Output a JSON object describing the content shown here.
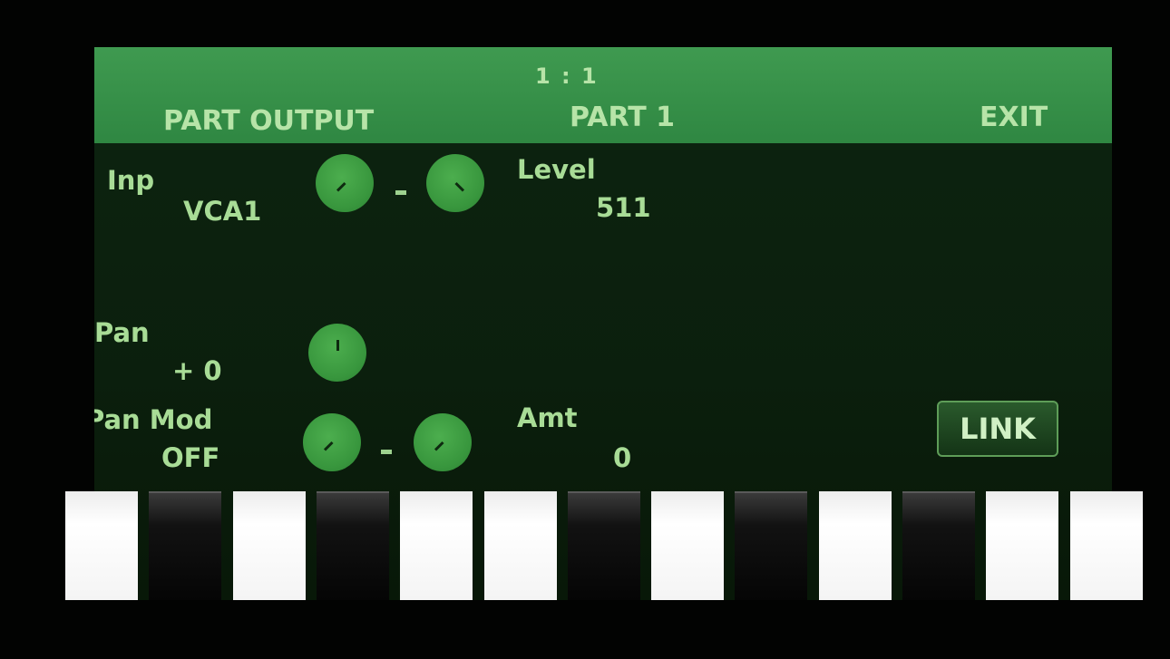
{
  "header": {
    "position": "1 : 1",
    "left_label": "PART OUTPUT",
    "center_label": "PART 1",
    "right_label": "EXIT"
  },
  "params": {
    "inp_label": "Inp",
    "inp_value": "VCA1",
    "level_label": "Level",
    "level_value": "511",
    "pan_label": "Pan",
    "pan_value": "+ 0",
    "panmod_label": "Pan Mod",
    "panmod_value": "OFF",
    "amt_label": "Amt",
    "amt_value": "0"
  },
  "link_button": "LINK",
  "keyboard": [
    "white",
    "black",
    "white",
    "black",
    "white",
    "white",
    "black",
    "white",
    "black",
    "white",
    "black",
    "white",
    "white"
  ],
  "colors": {
    "header": "#3a944b",
    "text": "#a8dc96",
    "knob": "#3b9a40",
    "background": "#0b1f0d"
  }
}
